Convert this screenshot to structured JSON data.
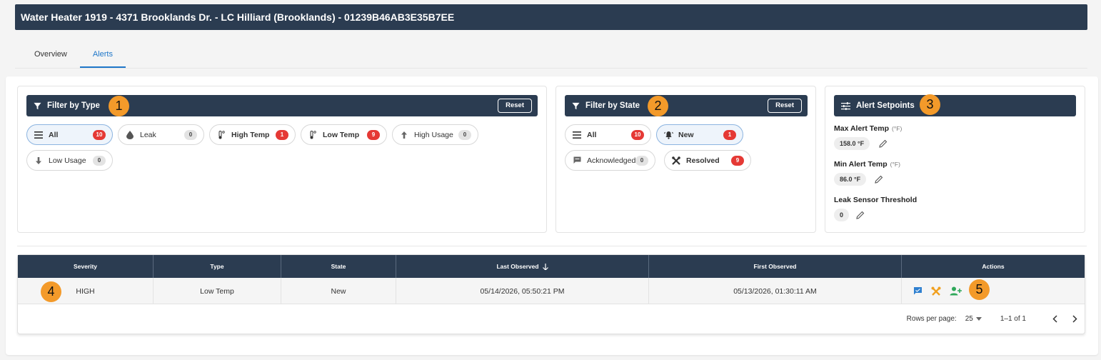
{
  "window": {
    "title": "Water Heater 1919 - 4371 Brooklands Dr. - LC Hilliard (Brooklands) - 01239B46AB3E35B7EE"
  },
  "tabs": [
    {
      "label": "Overview"
    },
    {
      "label": "Alerts",
      "active": true
    }
  ],
  "filter_type": {
    "title": "Filter by Type",
    "reset_label": "Reset",
    "chips": [
      {
        "label": "All",
        "count": "10",
        "icon": "list-icon",
        "selected": true
      },
      {
        "label": "Leak",
        "count": "0",
        "icon": "droplet-icon"
      },
      {
        "label": "High Temp",
        "count": "1",
        "icon": "thermometer-icon"
      },
      {
        "label": "Low Temp",
        "count": "9",
        "icon": "thermometer-icon"
      },
      {
        "label": "High Usage",
        "count": "0",
        "icon": "arrow-up-icon"
      },
      {
        "label": "Low Usage",
        "count": "0",
        "icon": "arrow-down-icon"
      }
    ]
  },
  "filter_state": {
    "title": "Filter by State",
    "reset_label": "Reset",
    "chips": [
      {
        "label": "All",
        "count": "10",
        "icon": "list-icon"
      },
      {
        "label": "New",
        "count": "1",
        "icon": "bell-alert-icon",
        "selected": true
      },
      {
        "label": "Acknowledged",
        "count": "0",
        "icon": "comment-icon"
      },
      {
        "label": "Resolved",
        "count": "9",
        "icon": "tools-icon"
      }
    ]
  },
  "setpoints": {
    "title": "Alert Setpoints",
    "items": [
      {
        "label": "Max Alert Temp",
        "unit": "(°F)",
        "value": "158.0 °F"
      },
      {
        "label": "Min Alert Temp",
        "unit": "(°F)",
        "value": "86.0 °F"
      },
      {
        "label": "Leak Sensor Threshold",
        "unit": "",
        "value": "0"
      }
    ]
  },
  "table": {
    "columns": [
      "Severity",
      "Type",
      "State",
      "Last Observed",
      "First Observed",
      "Actions"
    ],
    "rows": [
      {
        "severity": "HIGH",
        "type": "Low Temp",
        "state": "New",
        "last_observed": "05/14/2026, 05:50:21 PM",
        "first_observed": "05/13/2026, 01:30:11 AM"
      }
    ],
    "pagination": {
      "rows_per_page_label": "Rows per page:",
      "rows_per_page": "25",
      "range": "1–1 of 1"
    }
  },
  "callouts": [
    "1",
    "2",
    "3",
    "4",
    "5"
  ],
  "colors": {
    "header": "#2b3c51",
    "accent": "#1f77c9",
    "badge_red": "#e53935",
    "callout": "#f39a2a"
  }
}
